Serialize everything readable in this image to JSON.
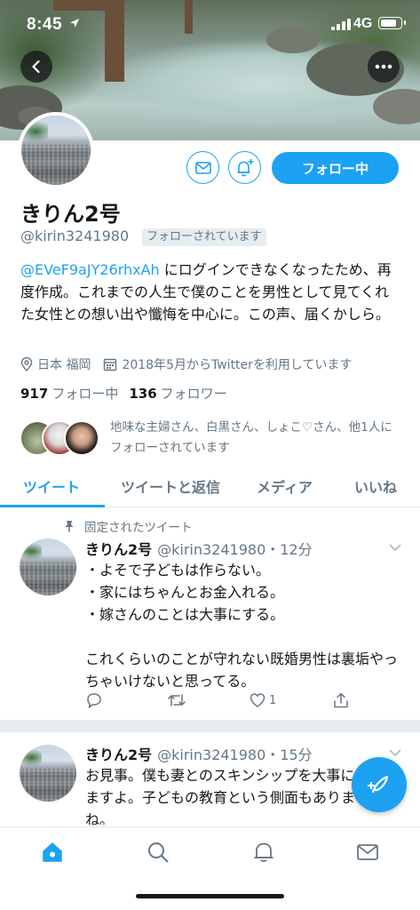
{
  "status_bar": {
    "time": "8:45",
    "network": "4G"
  },
  "profile": {
    "display_name": "きりん2号",
    "handle": "@kirin3241980",
    "follows_you_badge": "フォローされています",
    "follow_button_label": "フォロー中",
    "bio_mention": "@EVeF9aJY26rhxAh",
    "bio_text": " にログインできなくなったため、再度作成。これまでの人生で僕のことを男性として見てくれた女性との想い出や懺悔を中心に。この声、届くかしら。",
    "location": "日本 福岡",
    "joined": "2018年5月からTwitterを利用しています",
    "following_count": "917",
    "following_label": "フォロー中",
    "followers_count": "136",
    "followers_label": "フォロワー",
    "followed_by_text": "地味な主婦さん、白黒さん、しょこ♡さん、他1人にフォローされています"
  },
  "tabs": [
    {
      "label": "ツイート",
      "active": true
    },
    {
      "label": "ツイートと返信",
      "active": false
    },
    {
      "label": "メディア",
      "active": false
    },
    {
      "label": "いいね",
      "active": false
    }
  ],
  "pinned_label": "固定されたツイート",
  "tweets": [
    {
      "name": "きりん2号",
      "handle_time": "@kirin3241980・12分",
      "text": "・よそで子どもは作らない。\n・家にはちゃんとお金入れる。\n・嫁さんのことは大事にする。\n\nこれくらいのことが守れない既婚男性は裏垢やっちゃいけないと思ってる。",
      "likes": "1"
    },
    {
      "name": "きりん2号",
      "handle_time": "@kirin3241980・15分",
      "text": "お見事。僕も妻とのスキンシップを大事にしていますよ。子どもの教育という側面もありますよね。"
    }
  ],
  "icons": {
    "back": "chevron-left-icon",
    "more": "more-horizontal-icon",
    "message": "envelope-icon",
    "notify": "bell-plus-icon",
    "location": "map-pin-icon",
    "calendar": "calendar-icon",
    "pin": "pin-icon",
    "reply": "reply-icon",
    "retweet": "retweet-icon",
    "like": "heart-icon",
    "share": "share-icon",
    "compose": "compose-feather-icon",
    "nav_home": "home-icon",
    "nav_search": "search-icon",
    "nav_notifications": "bell-icon",
    "nav_messages": "envelope-icon"
  },
  "colors": {
    "accent": "#1da1f2",
    "text_primary": "#14171a",
    "text_secondary": "#657786",
    "divider": "#e6ecf0"
  }
}
